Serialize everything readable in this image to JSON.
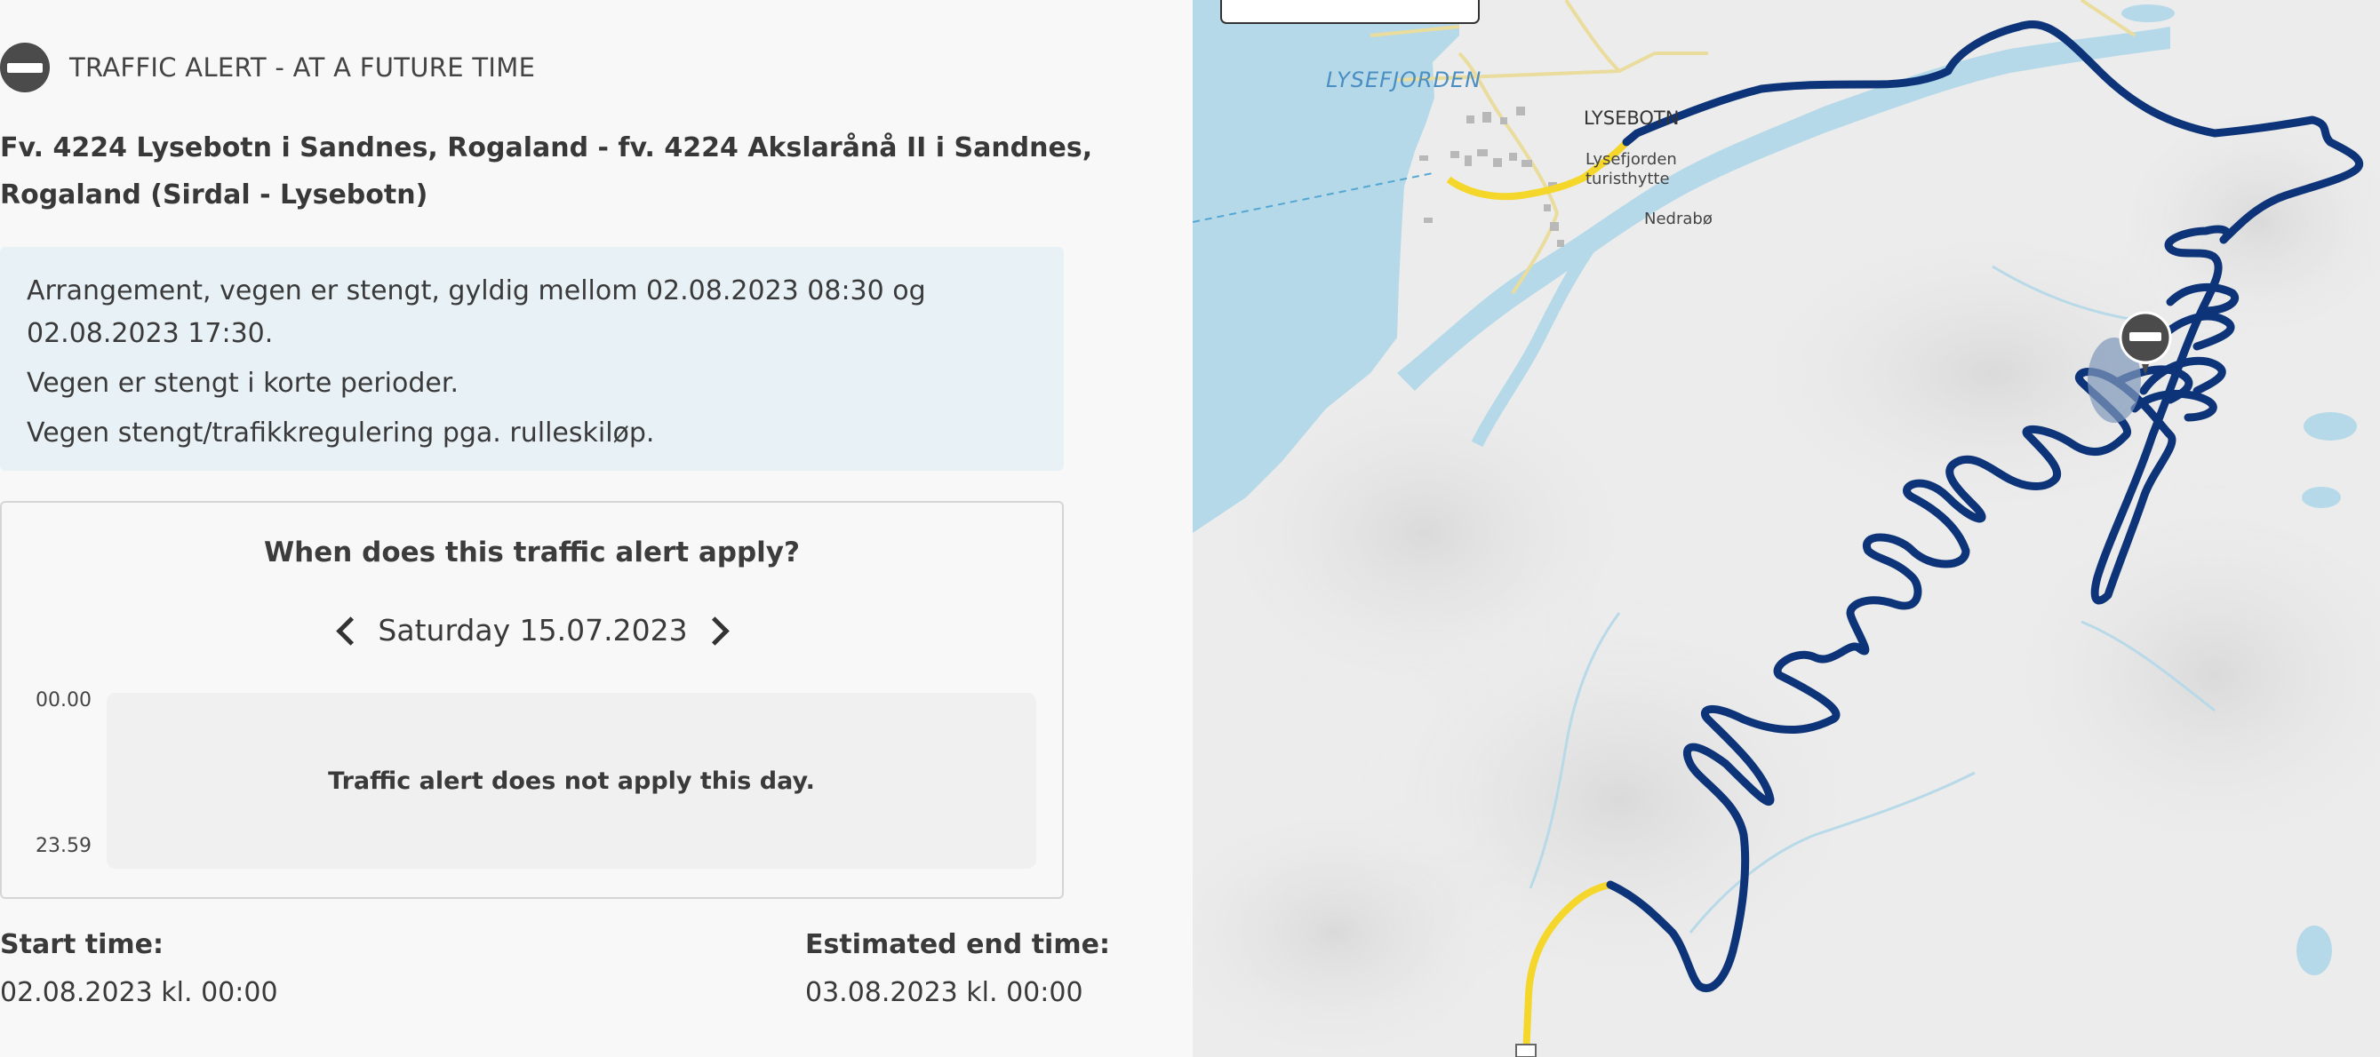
{
  "alert": {
    "header": "TRAFFIC ALERT - AT A FUTURE TIME",
    "icon": "no-entry-icon",
    "road": "Fv. 4224 Lysebotn i Sandnes, Rogaland - fv. 4224 Akslarånå II i Sandnes, Rogaland (Sirdal - Lysebotn)",
    "details": [
      "Arrangement, vegen er stengt, gyldig mellom 02.08.2023 08:30 og 02.08.2023 17:30.",
      "Vegen er stengt i korte perioder.",
      "Vegen stengt/trafikkregulering pga. rulleskiløp."
    ]
  },
  "schedule": {
    "title": "When does this traffic alert apply?",
    "date": "Saturday 15.07.2023",
    "time_start": "00.00",
    "time_end": "23.59",
    "message": "Traffic alert does not apply this day."
  },
  "times": {
    "start_label": "Start time:",
    "start_value": "02.08.2023 kl. 00:00",
    "end_label": "Estimated end time:",
    "end_value": "03.08.2023 kl. 00:00"
  },
  "map": {
    "labels": {
      "fjord": "LYSEFJORDEN",
      "town": "LYSEBOTN",
      "hut_line1": "Lysefjorden",
      "hut_line2": "turisthytte",
      "place": "Nedrabø"
    },
    "colors": {
      "water": "#b5d9e8",
      "route": "#0d3478",
      "road_yellow": "#f4d72a",
      "terrain": "#ececec"
    }
  }
}
